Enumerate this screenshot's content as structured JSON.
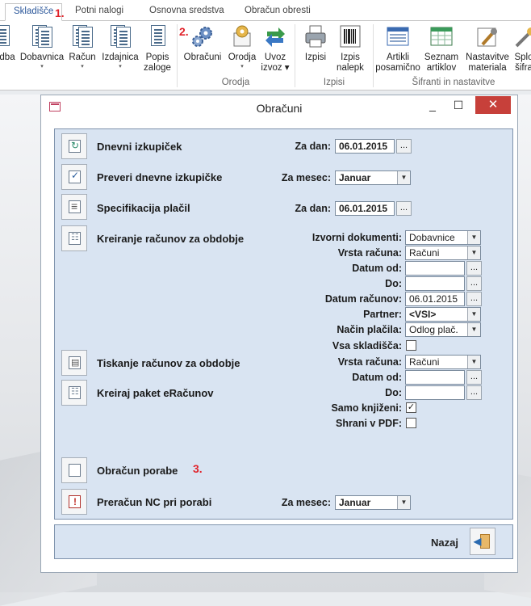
{
  "tabs": [
    {
      "label": "Skladišče",
      "active": true
    },
    {
      "label": "Potni nalogi"
    },
    {
      "label": "Osnovna sredstva"
    },
    {
      "label": "Obračun obresti"
    }
  ],
  "annotations": {
    "tab_marker": "1.",
    "ribbon_marker": "2.",
    "panel_marker": "3."
  },
  "ribbon": {
    "buttons": [
      {
        "line1": "dba",
        "line2": ""
      },
      {
        "line1": "Dobavnica",
        "line2": "▾"
      },
      {
        "line1": "Račun",
        "line2": "▾"
      },
      {
        "line1": "Izdajnica",
        "line2": "▾"
      },
      {
        "line1": "Popis",
        "line2": "zaloge"
      },
      {
        "line1": "Obračuni",
        "line2": ""
      },
      {
        "line1": "Orodja",
        "line2": "▾"
      },
      {
        "line1": "Uvoz",
        "line2": "izvoz ▾"
      },
      {
        "line1": "Izpisi",
        "line2": ""
      },
      {
        "line1": "Izpis",
        "line2": "nalepk"
      },
      {
        "line1": "Artikli",
        "line2": "posamično"
      },
      {
        "line1": "Seznam",
        "line2": "artiklov"
      },
      {
        "line1": "Nastavitve",
        "line2": "materiala"
      },
      {
        "line1": "Splo",
        "line2": "šifra"
      }
    ],
    "groups": {
      "orodja": "Orodja",
      "izpisi": "Izpisi",
      "sifranti": "Šifranti in nastavitve"
    }
  },
  "window": {
    "title": "Obračuni",
    "minimize": "_",
    "maximize": "☐",
    "close": "✕"
  },
  "rows": {
    "dnevni": {
      "label": "Dnevni izkupiček",
      "field_label": "Za dan:",
      "value": "06.01.2015",
      "dots": "..."
    },
    "preveri": {
      "label": "Preveri dnevne izkupičke",
      "field_label": "Za mesec:",
      "value": "Januar"
    },
    "specifikacija": {
      "label": "Specifikacija plačil",
      "field_label": "Za dan:",
      "value": "06.01.2015",
      "dots": "..."
    },
    "kreiranje": {
      "label": "Kreiranje računov za obdobje",
      "izvorni_label": "Izvorni dokumenti:",
      "izvorni_value": "Dobavnice",
      "vrsta_label": "Vrsta računa:",
      "vrsta_value": "Računi",
      "datum_od_label": "Datum od:",
      "datum_od_value": "",
      "datum_od_dots": "...",
      "do_label": "Do:",
      "do_value": "",
      "do_dots": "...",
      "datum_racunov_label": "Datum računov:",
      "datum_racunov_value": "06.01.2015",
      "datum_racunov_dots": "...",
      "partner_label": "Partner:",
      "partner_value": "<VSI>",
      "nacin_label": "Način plačila:",
      "nacin_value": "Odlog plač.",
      "vsa_label": "Vsa skladišča:",
      "vsa_checked": false
    },
    "tiskanje": {
      "label": "Tiskanje računov za obdobje",
      "vrsta_label": "Vrsta računa:",
      "vrsta_value": "Računi",
      "datum_od_label": "Datum od:",
      "datum_od_value": "",
      "datum_od_dots": "..."
    },
    "paket": {
      "label": "Kreiraj paket eRačunov",
      "do_label": "Do:",
      "do_value": "",
      "do_dots": "...",
      "samo_label": "Samo knjiženi:",
      "samo_checked": "✓",
      "shrani_label": "Shrani v PDF:",
      "shrani_checked": ""
    },
    "poraba": {
      "label": "Obračun porabe"
    },
    "preracun": {
      "label": "Preračun NC pri porabi",
      "field_label": "Za mesec:",
      "value": "Januar"
    }
  },
  "footer": {
    "nazaj": "Nazaj"
  },
  "colors": {
    "panel_bg": "#d9e4f2",
    "accent": "#2b579a",
    "marker": "#e0222a",
    "close_bg": "#c7403a"
  }
}
